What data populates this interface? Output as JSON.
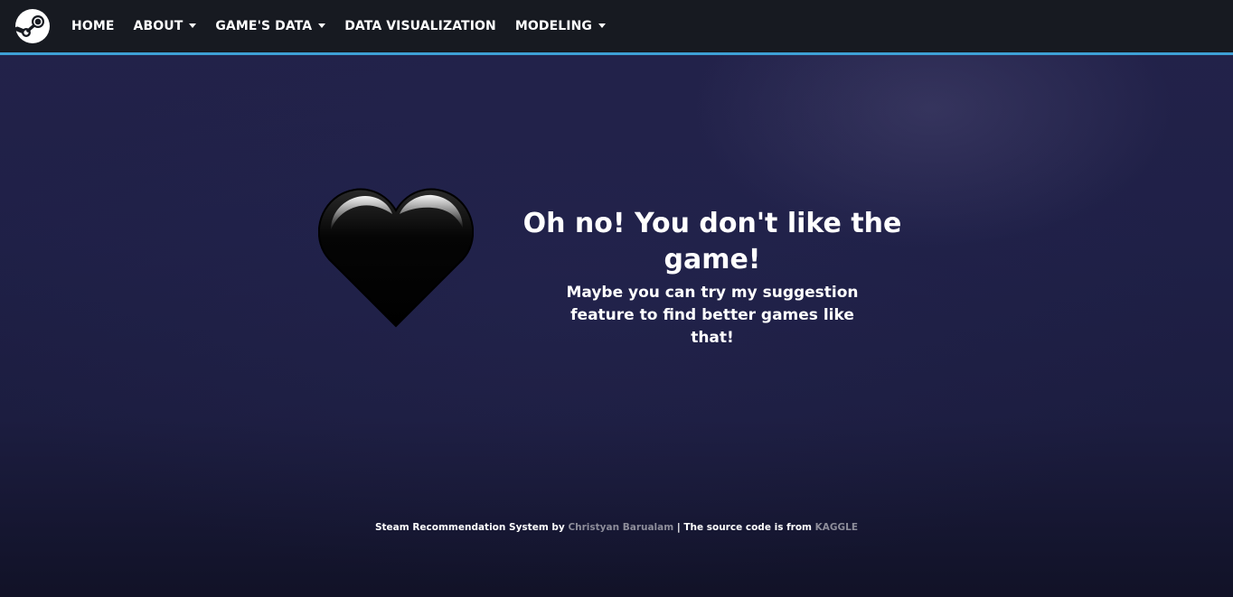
{
  "navbar": {
    "logo_icon": "steam-logo-icon",
    "accent_color": "#3ea0d6",
    "background_color": "#171a21",
    "items": [
      {
        "label": "HOME",
        "dropdown": false
      },
      {
        "label": "ABOUT",
        "dropdown": true
      },
      {
        "label": "GAME'S DATA",
        "dropdown": true
      },
      {
        "label": "DATA VISUALIZATION",
        "dropdown": false
      },
      {
        "label": "MODELING",
        "dropdown": true
      }
    ]
  },
  "main": {
    "icon": "black-heart-icon",
    "title": "Oh no! You don't like the game!",
    "subtitle": "Maybe you can try my suggestion feature to find better games like that!"
  },
  "footer": {
    "prefix": "Steam Recommendation System by ",
    "author_link": "Christyan Barualam",
    "separator": " | The source code is from ",
    "source_link": "KAGGLE"
  }
}
